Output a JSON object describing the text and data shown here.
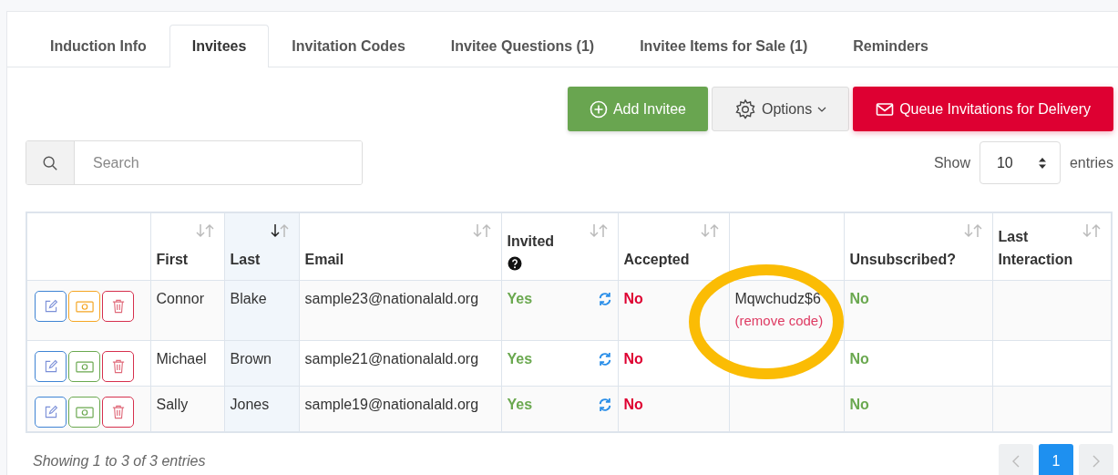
{
  "tabs": [
    {
      "label": "Induction Info",
      "selected": false
    },
    {
      "label": "Invitees",
      "selected": true
    },
    {
      "label": "Invitation Codes",
      "selected": false
    },
    {
      "label": "Invitee Questions (1)",
      "selected": false
    },
    {
      "label": "Invitee Items for Sale (1)",
      "selected": false
    },
    {
      "label": "Reminders",
      "selected": false
    }
  ],
  "toolbar": [
    {
      "kind": "add",
      "label": "Add Invitee"
    },
    {
      "kind": "options",
      "label": "Options"
    },
    {
      "kind": "queue",
      "label": "Queue Invitations for Delivery"
    }
  ],
  "search": {
    "placeholder": "Search"
  },
  "length": {
    "before": "Show",
    "value": "10",
    "after": "entries"
  },
  "columns": [
    {
      "kind": "actions",
      "sortable": false,
      "sorted": false,
      "help": false
    },
    {
      "kind": "text",
      "label": "First",
      "sortable": true,
      "sorted": false,
      "help": false
    },
    {
      "kind": "text",
      "label": "Last",
      "sortable": true,
      "sorted": true,
      "help": false
    },
    {
      "kind": "text",
      "label": "Email",
      "sortable": true,
      "sorted": false,
      "help": false
    },
    {
      "kind": "invited",
      "label": "Invited",
      "help": true,
      "sortable": true,
      "sorted": false
    },
    {
      "kind": "bad",
      "label": "Accepted",
      "sortable": true,
      "sorted": false,
      "help": false
    },
    {
      "kind": "code",
      "sortable": false,
      "sorted": false,
      "help": false
    },
    {
      "kind": "good",
      "label": "Unsubscribed?",
      "sortable": true,
      "sorted": false,
      "help": false
    },
    {
      "kind": "text",
      "label": "Last\nInteraction",
      "sortable": true,
      "sorted": false,
      "help": false
    }
  ],
  "rows": [
    {
      "color": "#f5a623",
      "cells": [
        "",
        "Connor",
        "Blake",
        "sample23@nationalald.org",
        "Yes",
        "No",
        "Mqwchudz$6",
        "No",
        ""
      ],
      "remove_link": "(remove code)",
      "highlighted": true
    },
    {
      "color": "#6aa84f",
      "cells": [
        "",
        "Michael",
        "Brown",
        "sample21@nationalald.org",
        "Yes",
        "No",
        "",
        "No",
        ""
      ],
      "highlighted": false
    },
    {
      "color": "#6aa84f",
      "cells": [
        "",
        "Sally",
        "Jones",
        "sample19@nationalald.org",
        "Yes",
        "No",
        "",
        "No",
        ""
      ],
      "highlighted": false
    }
  ],
  "info": "Showing 1 to 3 of 3 entries",
  "pages": [
    {
      "label": "1",
      "selected": true
    }
  ]
}
